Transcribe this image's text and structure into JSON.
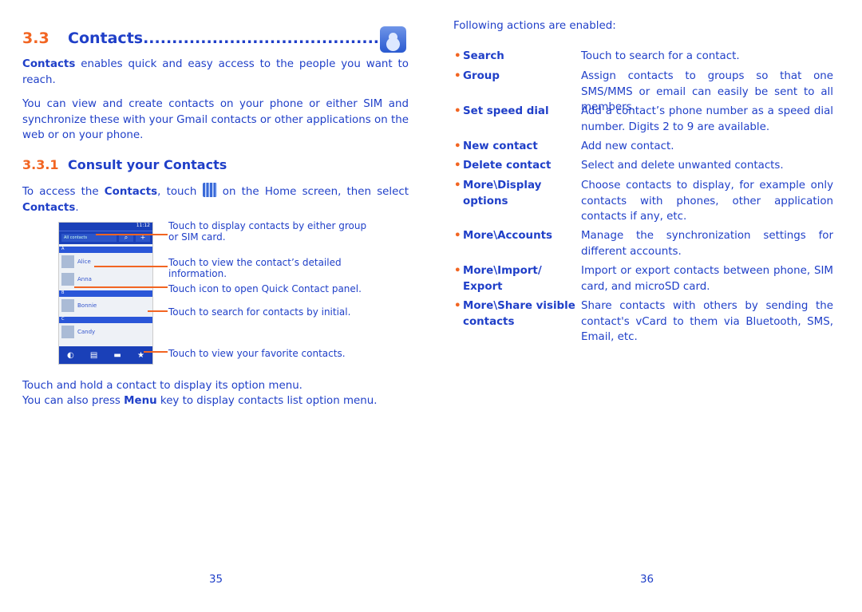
{
  "left": {
    "heading": {
      "number": "3.3",
      "title": "Contacts",
      "leader": "........................................................"
    },
    "intro_bold": "Contacts",
    "intro": " enables quick and easy access to the people you want to reach.",
    "para2": "You can view and create contacts on your phone or either SIM and synchronize these with your Gmail contacts or other applications on the web or on your phone.",
    "subheading": {
      "number": "3.3.1",
      "title": "Consult your Contacts"
    },
    "access": {
      "a": "To access the ",
      "b": "Contacts",
      "c": ", touch ",
      "d": " on the Home screen, then select ",
      "e": "Contacts",
      "f": "."
    },
    "phone": {
      "time": "11:12",
      "filter": "All contacts",
      "search": "⌕",
      "add": "+",
      "sections": [
        "A",
        "B",
        "C"
      ],
      "contacts": [
        "Alice",
        "Anna",
        "Bonnie",
        "Candy"
      ],
      "nav": [
        "Phone",
        "Call log",
        "Contacts",
        "Favorites"
      ]
    },
    "annotations": [
      "Touch to display contacts by either group or SIM card.",
      "Touch to view the contact’s detailed information.",
      "Touch icon to open Quick Contact panel.",
      "Touch to search for contacts by initial.",
      "Touch to view your favorite contacts."
    ],
    "hold": "Touch and hold a contact to display its option menu.",
    "menu": {
      "a": "You can also press ",
      "b": "Menu",
      "c": " key to display contacts list option menu."
    },
    "page": "35"
  },
  "right": {
    "intro": "Following actions are enabled:",
    "items": [
      {
        "term": "Search",
        "desc": "Touch to search for a contact."
      },
      {
        "term": "Group",
        "desc": "Assign contacts to groups so that one SMS/MMS or email can easily be sent to all members."
      },
      {
        "term": "Set speed dial",
        "desc": "Add a contact’s phone number as a speed dial number.  Digits 2 to 9 are available."
      },
      {
        "term": "New contact",
        "desc": "Add new contact."
      },
      {
        "term": "Delete contact",
        "desc": "Select and delete unwanted contacts."
      },
      {
        "term": "More\\Display options",
        "desc": "Choose contacts to display, for example only contacts with phones, other application contacts if any, etc."
      },
      {
        "term": "More\\Accounts",
        "desc": "Manage the synchronization settings for different accounts."
      },
      {
        "term": "More\\Import/ Export",
        "desc": "Import or export contacts between phone, SIM card, and microSD card."
      },
      {
        "term": "More\\Share visible contacts",
        "desc": "Share contacts with others by sending the contact's vCard to them via Bluetooth, SMS, Email, etc."
      }
    ],
    "page": "36"
  },
  "colors": {
    "text": "#1f3fc8",
    "accent": "#f26522"
  }
}
